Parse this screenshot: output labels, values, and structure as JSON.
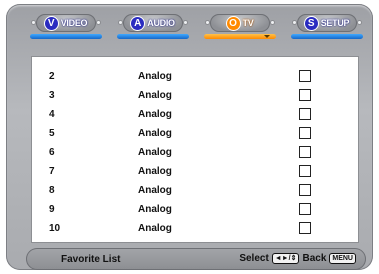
{
  "tabs": [
    {
      "letter": "V",
      "label": "VIDEO",
      "letter_color": "#2a2cc0",
      "active": false
    },
    {
      "letter": "A",
      "label": "AUDIO",
      "letter_color": "#2a2cc0",
      "active": false
    },
    {
      "letter": "O",
      "label": "TV",
      "letter_color": "#ff8a00",
      "active": true
    },
    {
      "letter": "S",
      "label": "SETUP",
      "letter_color": "#2a2cc0",
      "active": false
    }
  ],
  "rows": [
    {
      "number": "2",
      "type": "Analog",
      "checked": false
    },
    {
      "number": "3",
      "type": "Analog",
      "checked": false
    },
    {
      "number": "4",
      "type": "Analog",
      "checked": false
    },
    {
      "number": "5",
      "type": "Analog",
      "checked": false
    },
    {
      "number": "6",
      "type": "Analog",
      "checked": false
    },
    {
      "number": "7",
      "type": "Analog",
      "checked": false
    },
    {
      "number": "8",
      "type": "Analog",
      "checked": false
    },
    {
      "number": "9",
      "type": "Analog",
      "checked": false
    },
    {
      "number": "10",
      "type": "Analog",
      "checked": false
    }
  ],
  "footer": {
    "title": "Favorite List",
    "select_label": "Select",
    "select_keys": "◄►/⇕",
    "back_label": "Back",
    "back_key": "MENU"
  },
  "colors": {
    "accent_blue": "#1668c9",
    "accent_orange": "#ff8a00"
  }
}
